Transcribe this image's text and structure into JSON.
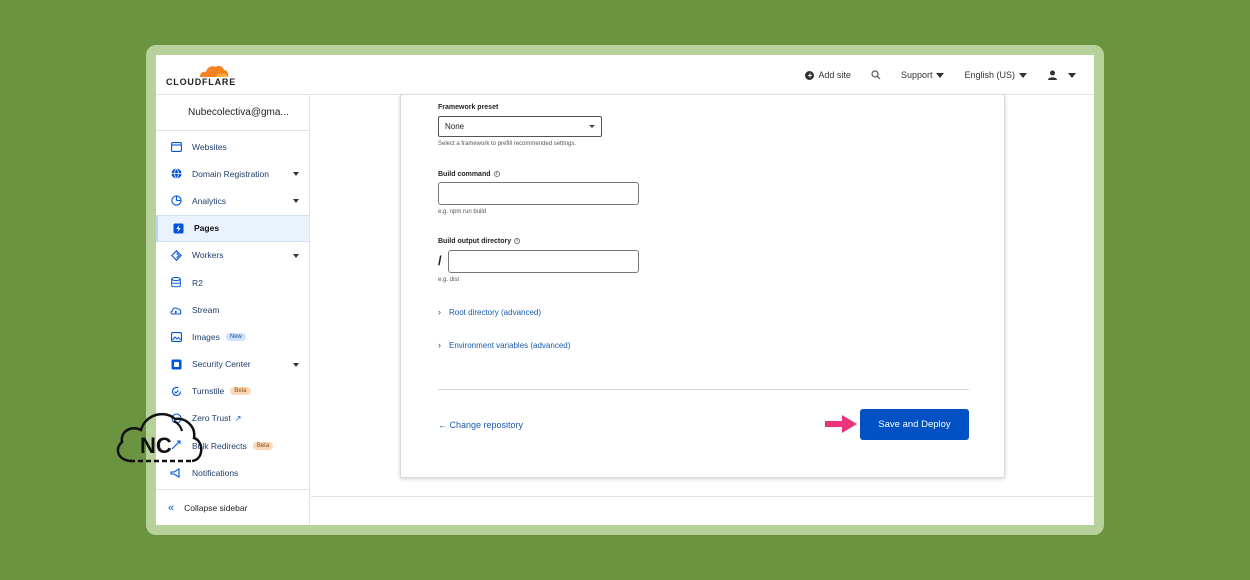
{
  "brand": {
    "name": "CLOUDFLARE",
    "orange": "#f6821f",
    "accent": "#0051c3"
  },
  "topnav": {
    "add_site": "Add site",
    "support": "Support",
    "language": "English (US)"
  },
  "sidebar": {
    "account": "Nubecolectiva@gma...",
    "items": [
      {
        "label": "Websites",
        "icon": "browser-window-icon"
      },
      {
        "label": "Domain Registration",
        "icon": "globe-icon"
      },
      {
        "label": "Analytics",
        "icon": "pie-chart-icon"
      },
      {
        "label": "Pages",
        "icon": "lightning-page-icon"
      },
      {
        "label": "Workers",
        "icon": "workers-diamond-icon"
      },
      {
        "label": "R2",
        "icon": "database-icon"
      },
      {
        "label": "Stream",
        "icon": "cloud-play-icon"
      },
      {
        "label": "Images",
        "icon": "image-icon",
        "badge": "New"
      },
      {
        "label": "Security Center",
        "icon": "shield-box-icon"
      },
      {
        "label": "Turnstile",
        "icon": "refresh-check-icon",
        "badge": "Beta"
      },
      {
        "label": "Zero Trust",
        "icon": "zero-trust-icon"
      },
      {
        "label": "Bulk Redirects",
        "icon": "redirect-icon",
        "badge": "Beta"
      },
      {
        "label": "Notifications",
        "icon": "megaphone-icon"
      }
    ],
    "collapse": "Collapse sidebar"
  },
  "form": {
    "framework_label": "Framework preset",
    "framework_value": "None",
    "framework_hint": "Select a framework to prefill recommended settings.",
    "build_command_label": "Build command",
    "build_command_value": "",
    "build_command_hint": "e.g. npm run build",
    "output_dir_label": "Build output directory",
    "output_dir_prefix": "/",
    "output_dir_value": "",
    "output_dir_hint": "e.g. dist",
    "root_dir": "Root directory (advanced)",
    "env_vars": "Environment variables (advanced)",
    "change_repo": "← Change repository",
    "save_deploy": "Save and Deploy"
  },
  "watermark": {
    "text": "NC",
    "arrow_color": "#e8347a"
  }
}
